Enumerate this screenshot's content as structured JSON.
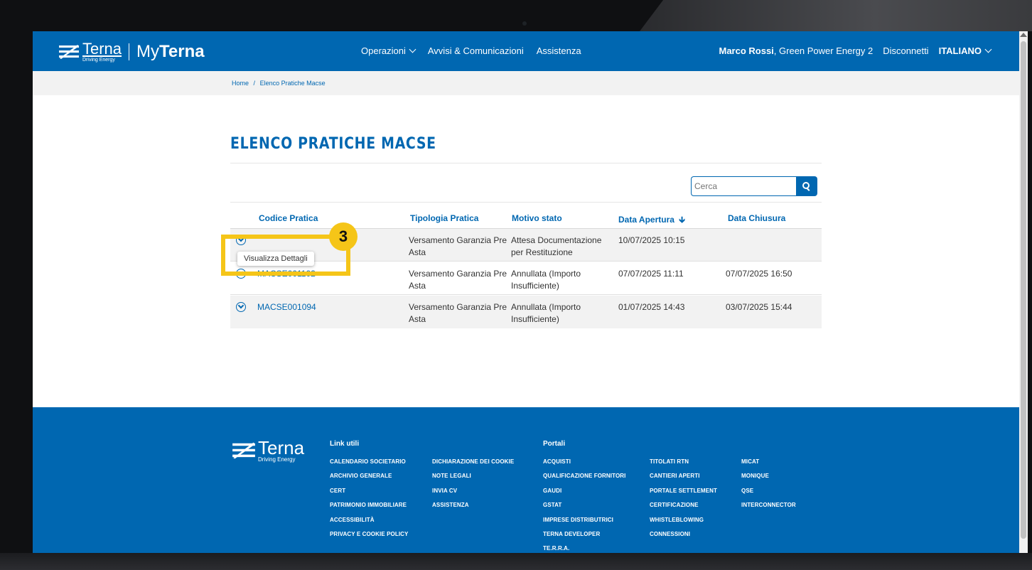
{
  "header": {
    "logo_brand": "Terna",
    "logo_tagline": "Driving Energy",
    "logo_my": "My",
    "logo_my_brand": "Terna",
    "nav": [
      "Operazioni",
      "Avvisi & Comunicazioni",
      "Assistenza"
    ],
    "user_name": "Marco Rossi",
    "user_company": ", Green Power Energy 2",
    "logout": "Disconnetti",
    "language": "ITALIANO"
  },
  "breadcrumb": {
    "home": "Home",
    "separator": "/",
    "current": "Elenco Pratiche Macse"
  },
  "page_title": "ELENCO PRATICHE MACSE",
  "search": {
    "placeholder": "Cerca"
  },
  "table": {
    "headers": {
      "code": "Codice Pratica",
      "type": "Tipologia Pratica",
      "reason": "Motivo stato",
      "open": "Data Apertura",
      "close": "Data Chiusura"
    },
    "rows": [
      {
        "code": "",
        "type_l1": "Versamento Garanzia Pre",
        "type_l2": "Asta",
        "reason_l1": "Attesa Documentazione",
        "reason_l2": "per Restituzione",
        "open": "10/07/2025 10:15",
        "close": ""
      },
      {
        "code": "MACSE001102",
        "type_l1": "Versamento Garanzia Pre",
        "type_l2": "Asta",
        "reason_l1": "Annullata (Importo",
        "reason_l2": "Insufficiente)",
        "open": "07/07/2025 11:11",
        "close": "07/07/2025 16:50"
      },
      {
        "code": "MACSE001094",
        "type_l1": "Versamento Garanzia Pre",
        "type_l2": "Asta",
        "reason_l1": "Annullata (Importo",
        "reason_l2": "Insufficiente)",
        "open": "01/07/2025 14:43",
        "close": "03/07/2025 15:44"
      }
    ]
  },
  "tooltip": "Visualizza Dettagli",
  "callout_number": "3",
  "footer": {
    "logo_brand": "Terna",
    "logo_tagline": "Driving Energy",
    "link_utili_title": "Link utili",
    "link_utili_col1": [
      "CALENDARIO SOCIETARIO",
      "ARCHIVIO GENERALE",
      "CERT",
      "PATRIMONIO IMMOBILIARE",
      "ACCESSIBILITÀ",
      "PRIVACY E COOKIE POLICY"
    ],
    "link_utili_col2": [
      "DICHIARAZIONE DEI COOKIE",
      "NOTE LEGALI",
      "INVIA CV",
      "ASSISTENZA"
    ],
    "portali_title": "Portali",
    "portali_col1": [
      "ACQUISTI",
      "QUALIFICAZIONE FORNITORI",
      "GAUDI",
      "GSTAT",
      "IMPRESE DISTRIBUTRICI",
      "TERNA DEVELOPER",
      "TE.R.R.A."
    ],
    "portali_col2": [
      "TITOLATI RTN",
      "CANTIERI APERTI",
      "PORTALE SETTLEMENT",
      "CERTIFICAZIONE",
      "WHISTLEBLOWING",
      "CONNESSIONI"
    ],
    "portali_col3": [
      "MICAT",
      "MONIQUE",
      "QSE",
      "INTERCONNECTOR"
    ]
  },
  "colors": {
    "brand_blue": "#0067b1",
    "callout_yellow": "#f5c518"
  }
}
